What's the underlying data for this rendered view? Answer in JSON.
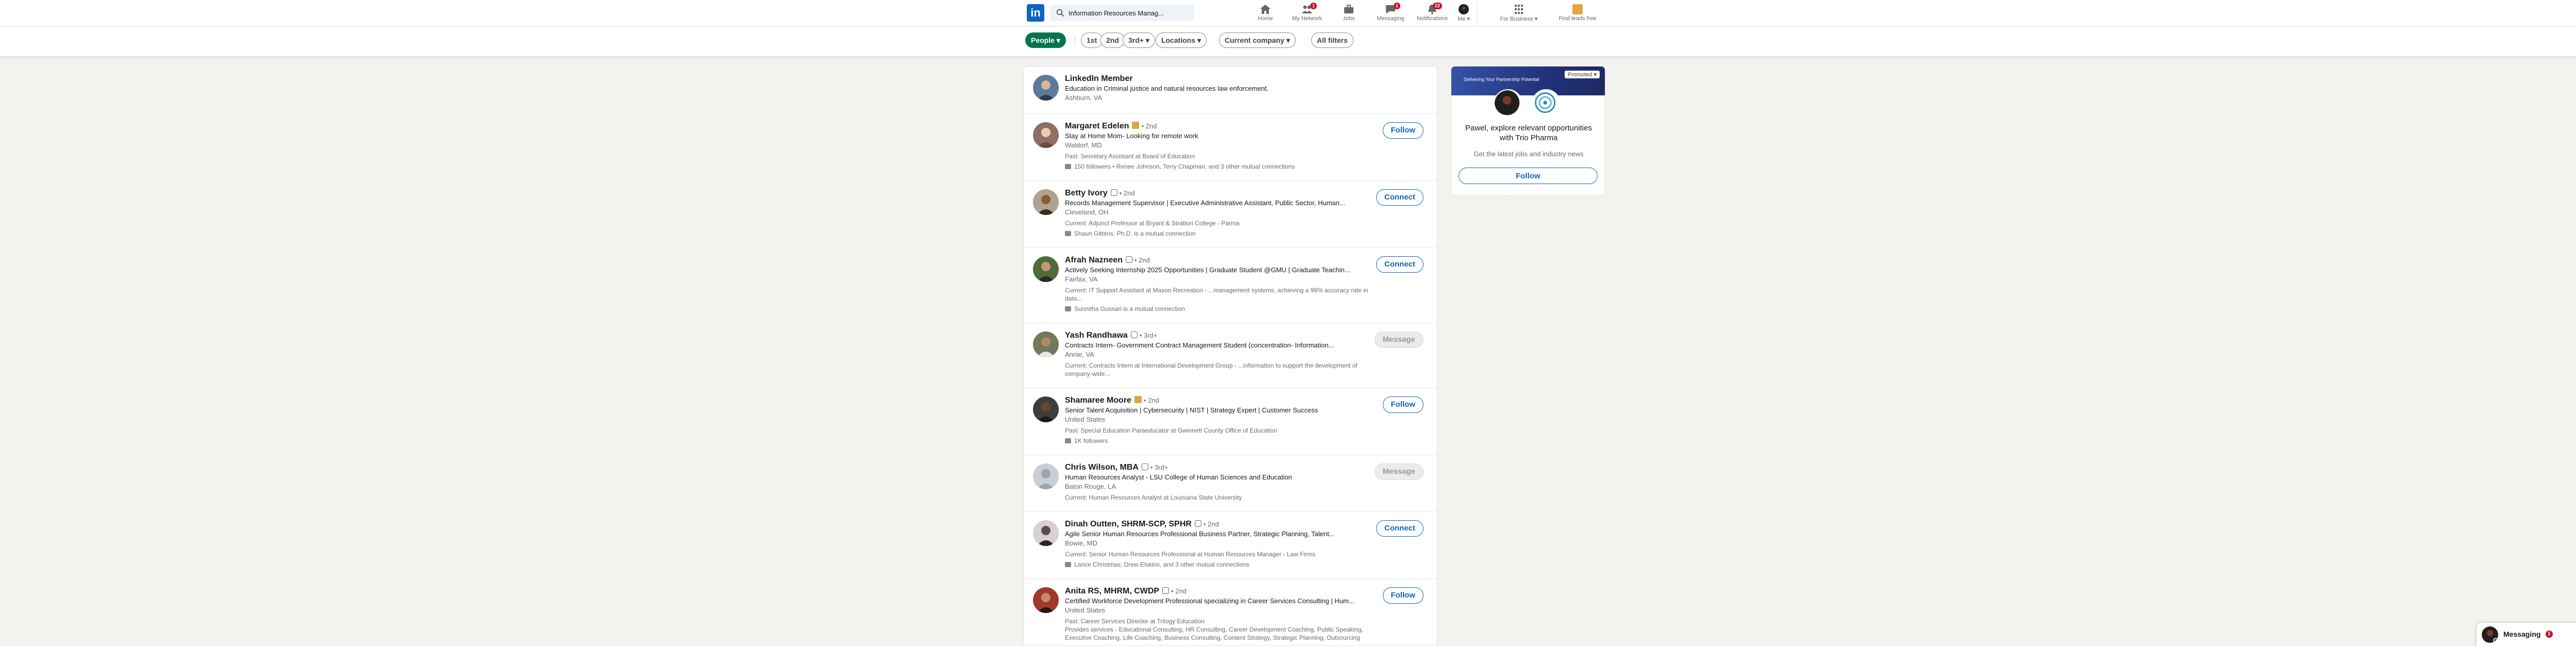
{
  "nav": {
    "logo_text": "in",
    "search_value": "Information Resources Manag...",
    "search_placeholder": "Search",
    "items": [
      {
        "label": "Home",
        "badge": "0"
      },
      {
        "label": "My Network",
        "badge": "1"
      },
      {
        "label": "Jobs",
        "badge": ""
      },
      {
        "label": "Messaging",
        "badge": "1"
      },
      {
        "label": "Notifications",
        "badge": "22"
      },
      {
        "label": "Me",
        "badge": ""
      },
      {
        "label": "For Business",
        "badge": ""
      },
      {
        "label": "Find leads free",
        "badge": ""
      }
    ]
  },
  "filters": {
    "people": "People",
    "first": "1st",
    "second": "2nd",
    "third": "3rd+",
    "locations": "Locations",
    "current_company": "Current company",
    "all_filters": "All filters"
  },
  "results": [
    {
      "name": "LinkedIn Member",
      "degree": "",
      "headline": "Education in Criminal justice and natural resources law enforcement.",
      "location": "Ashburn, VA",
      "current": "",
      "mutual": "",
      "action": "",
      "avatar_color": "#5b7a9c"
    },
    {
      "name": "Margaret Edelen",
      "degree": "• 2nd",
      "headline": "Stay at Home Mom- Looking for remote work",
      "location": "Waldorf, MD",
      "current": "Past: Secretary Assistant at Board of Education",
      "mutual": "150 followers • Renee Johnson, Terry Chapman, and 3 other mutual connections",
      "action": "Follow",
      "avatar_color": "#8e6f63"
    },
    {
      "name": "Betty Ivory",
      "degree": "• 2nd",
      "headline": "Records Management Supervisor | Executive Administrative Assistant, Public Sector, Human...",
      "location": "Cleveland, OH",
      "current": "Current: Adjunct Professor at Bryant & Stratton College - Parma",
      "mutual": "Shaun Gittens, Ph.D. is a mutual connection",
      "action": "Connect",
      "avatar_color": "#7b5a45"
    },
    {
      "name": "Afrah Nazneen",
      "degree": "• 2nd",
      "headline": "Actively Seeking Internship 2025 Opportunities | Graduate Student @GMU | Graduate Teachin...",
      "location": "Fairfax, VA",
      "current": "Current: IT Support Assistant at Mason Recreation - ...management systems, achieving a 98% accuracy rate in",
      "current2": "data...",
      "mutual": "Sunnitha Gussari is a mutual connection",
      "action": "Connect",
      "avatar_color": "#4f6b3c"
    },
    {
      "name": "Yash Randhawa",
      "degree": "• 3rd+",
      "headline": "Contracts Intern- Government Contract Management Student (concentration- Information...",
      "location": "Annie, VA",
      "current": "Current: Contracts Intern at International Development Group - ...information to support the development of",
      "current2": "company-wide...",
      "mutual": "",
      "action": "Message",
      "action_disabled": true,
      "avatar_color": "#6f7b5c"
    },
    {
      "name": "Shamaree Moore",
      "degree": "• 2nd",
      "headline": "Senior Talent Acquisition | Cybersecurity | NIST | Strategy Expert | Customer Success",
      "location": "United States",
      "current": "Past: Special Education Paraeducator at Gwinnett County Office of Education",
      "mutual": "1K followers",
      "action": "Follow",
      "avatar_color": "#3d3d3d"
    },
    {
      "name": "Chris Wilson, MBA",
      "degree": "• 3rd+",
      "headline": "Human Resources Analyst - LSU College of Human Sciences and Education",
      "location": "Baton Rouge, LA",
      "current": "Current: Human Resources Analyst at Louisiana State University",
      "mutual": "",
      "action": "Message",
      "action_disabled": true,
      "avatar_color": "#9aa5b1"
    },
    {
      "name": "Dinah Outten, SHRM-SCP, SPHR",
      "degree": "• 2nd",
      "headline": "Agile Senior Human Resources Professional Business Partner, Strategic Planning, Talent...",
      "location": "Bowie, MD",
      "current": "Current: Senior Human Resources Professional at Human Resources Manager - Law Firms",
      "mutual": "Lance Christmas, Drew Elskins, and 3 other mutual connections",
      "action": "Connect",
      "avatar_color": "#5e4a52"
    },
    {
      "name": "Anita RS, MHRM, CWDP",
      "degree": "• 2nd",
      "headline": "Certified Workforce Development Professional specializing in Career Services Consulting | Hum...",
      "location": "United States",
      "current": "Past: Career Services Director at Trilogy Education",
      "current2": "Provides services - Educational Consulting, HR Consulting, Career Development Coaching, Public Speaking,",
      "mutual": "Executive Coaching, Life Coaching, Business Consulting, Content Strategy, Strategic Planning, Outsourcing",
      "action": "Follow",
      "avatar_color": "#a0392a"
    }
  ],
  "ad": {
    "promoted": "Promoted",
    "tagline": "Delivering Your Partnership Potential",
    "title": "Pawel, explore relevant opportunities with Trio Pharma",
    "subtitle": "Get the latest jobs and industry news",
    "button": "Follow"
  },
  "messaging": {
    "label": "Messaging",
    "count": "1"
  }
}
